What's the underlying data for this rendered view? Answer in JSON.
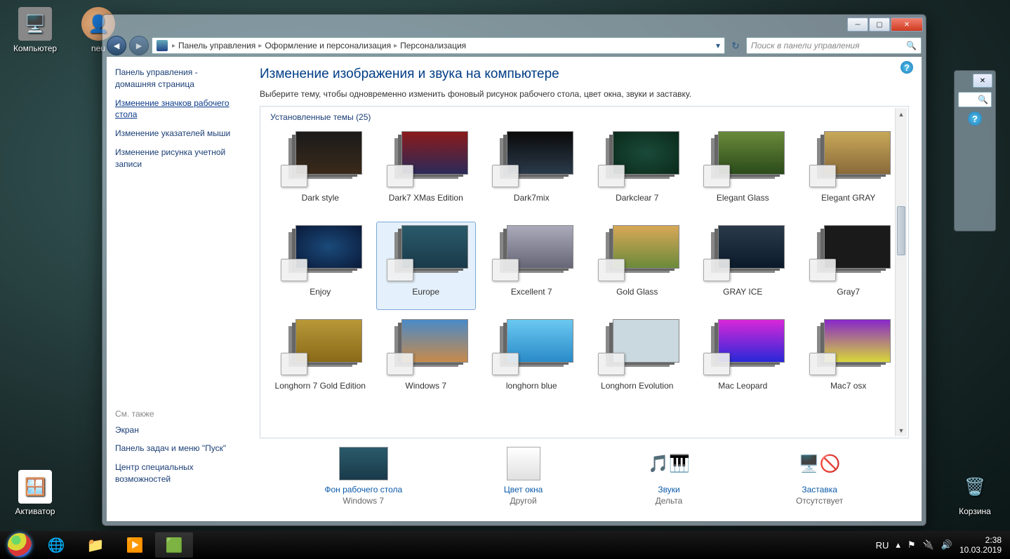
{
  "desktop": {
    "computer": "Компьютер",
    "user": "neu",
    "activator": "Активатор",
    "recycle": "Корзина"
  },
  "window": {
    "breadcrumb": {
      "a": "Панель управления",
      "b": "Оформление и персонализация",
      "c": "Персонализация"
    },
    "search_placeholder": "Поиск в панели управления"
  },
  "sidebar": {
    "home": "Панель управления - домашняя страница",
    "links": [
      "Изменение значков рабочего стола",
      "Изменение указателей мыши",
      "Изменение рисунка учетной записи"
    ],
    "seealso_title": "См. также",
    "seealso": [
      "Экран",
      "Панель задач и меню \"Пуск\"",
      "Центр специальных возможностей"
    ]
  },
  "main": {
    "title": "Изменение изображения и звука на компьютере",
    "subtitle": "Выберите тему, чтобы одновременно изменить фоновый рисунок рабочего стола, цвет окна, звуки и заставку.",
    "themes_header": "Установленные темы (25)",
    "themes": [
      "Dark style",
      "Dark7 XMas Edition",
      "Dark7mix",
      "Darkclear 7",
      "Elegant Glass",
      "Elegant GRAY",
      "Enjoy",
      "Europe",
      "Excellent 7",
      "Gold Glass",
      "GRAY ICE",
      "Gray7",
      "Longhorn 7 Gold Edition",
      "Windows 7",
      "longhorn blue",
      "Longhorn Evolution",
      "Mac Leopard",
      "Mac7 osx"
    ],
    "selected_index": 7
  },
  "bottom": {
    "bg": {
      "label": "Фон рабочего стола",
      "value": "Windows 7"
    },
    "color": {
      "label": "Цвет окна",
      "value": "Другой"
    },
    "sounds": {
      "label": "Звуки",
      "value": "Дельта"
    },
    "saver": {
      "label": "Заставка",
      "value": "Отсутствует"
    }
  },
  "taskbar": {
    "lang": "RU",
    "time": "2:38",
    "date": "10.03.2019"
  }
}
